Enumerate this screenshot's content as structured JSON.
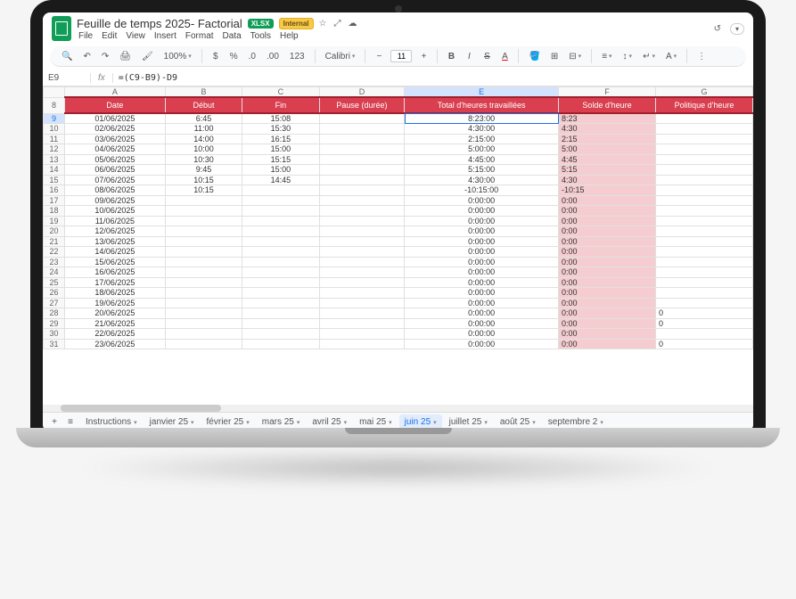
{
  "doc": {
    "name": "Feuille de temps 2025- Factorial",
    "badge_xlsx": "XLSX",
    "badge_internal": "Internal"
  },
  "menus": [
    "File",
    "Edit",
    "View",
    "Insert",
    "Format",
    "Data",
    "Tools",
    "Help"
  ],
  "toolbar": {
    "zoom": "100%",
    "font": "Calibri",
    "font_size": "11",
    "number_fmt": "123"
  },
  "formula": {
    "namebox": "E9",
    "fx": "fx",
    "value": "=(C9-B9)-D9"
  },
  "columns": [
    "A",
    "B",
    "C",
    "D",
    "E",
    "F",
    "G"
  ],
  "headers": {
    "A": "Date",
    "B": "Début",
    "C": "Fin",
    "D": "Pause (durée)",
    "E": "Total d'heures travaillées",
    "F": "Solde d'heure",
    "G": "Politique d'heure"
  },
  "chart_data": {
    "type": "table",
    "rows": [
      {
        "n": 9,
        "date": "01/06/2025",
        "debut": "6:45",
        "fin": "15:08",
        "pause": "",
        "total": "8:23:00",
        "solde": "8:23",
        "politique": ""
      },
      {
        "n": 10,
        "date": "02/06/2025",
        "debut": "11:00",
        "fin": "15:30",
        "pause": "",
        "total": "4:30:00",
        "solde": "4:30",
        "politique": ""
      },
      {
        "n": 11,
        "date": "03/06/2025",
        "debut": "14:00",
        "fin": "16:15",
        "pause": "",
        "total": "2:15:00",
        "solde": "2:15",
        "politique": ""
      },
      {
        "n": 12,
        "date": "04/06/2025",
        "debut": "10:00",
        "fin": "15:00",
        "pause": "",
        "total": "5:00:00",
        "solde": "5:00",
        "politique": ""
      },
      {
        "n": 13,
        "date": "05/06/2025",
        "debut": "10:30",
        "fin": "15:15",
        "pause": "",
        "total": "4:45:00",
        "solde": "4:45",
        "politique": ""
      },
      {
        "n": 14,
        "date": "06/06/2025",
        "debut": "9:45",
        "fin": "15:00",
        "pause": "",
        "total": "5:15:00",
        "solde": "5:15",
        "politique": ""
      },
      {
        "n": 15,
        "date": "07/06/2025",
        "debut": "10:15",
        "fin": "14:45",
        "pause": "",
        "total": "4:30:00",
        "solde": "4:30",
        "politique": ""
      },
      {
        "n": 16,
        "date": "08/06/2025",
        "debut": "10:15",
        "fin": "",
        "pause": "",
        "total": "-10:15:00",
        "solde": "-10:15",
        "politique": ""
      },
      {
        "n": 17,
        "date": "09/06/2025",
        "debut": "",
        "fin": "",
        "pause": "",
        "total": "0:00:00",
        "solde": "0:00",
        "politique": ""
      },
      {
        "n": 18,
        "date": "10/06/2025",
        "debut": "",
        "fin": "",
        "pause": "",
        "total": "0:00:00",
        "solde": "0:00",
        "politique": ""
      },
      {
        "n": 19,
        "date": "11/06/2025",
        "debut": "",
        "fin": "",
        "pause": "",
        "total": "0:00:00",
        "solde": "0:00",
        "politique": ""
      },
      {
        "n": 20,
        "date": "12/06/2025",
        "debut": "",
        "fin": "",
        "pause": "",
        "total": "0:00:00",
        "solde": "0:00",
        "politique": ""
      },
      {
        "n": 21,
        "date": "13/06/2025",
        "debut": "",
        "fin": "",
        "pause": "",
        "total": "0:00:00",
        "solde": "0:00",
        "politique": ""
      },
      {
        "n": 22,
        "date": "14/06/2025",
        "debut": "",
        "fin": "",
        "pause": "",
        "total": "0:00:00",
        "solde": "0:00",
        "politique": ""
      },
      {
        "n": 23,
        "date": "15/06/2025",
        "debut": "",
        "fin": "",
        "pause": "",
        "total": "0:00:00",
        "solde": "0:00",
        "politique": ""
      },
      {
        "n": 24,
        "date": "16/06/2025",
        "debut": "",
        "fin": "",
        "pause": "",
        "total": "0:00:00",
        "solde": "0:00",
        "politique": ""
      },
      {
        "n": 25,
        "date": "17/06/2025",
        "debut": "",
        "fin": "",
        "pause": "",
        "total": "0:00:00",
        "solde": "0:00",
        "politique": ""
      },
      {
        "n": 26,
        "date": "18/06/2025",
        "debut": "",
        "fin": "",
        "pause": "",
        "total": "0:00:00",
        "solde": "0:00",
        "politique": ""
      },
      {
        "n": 27,
        "date": "19/06/2025",
        "debut": "",
        "fin": "",
        "pause": "",
        "total": "0:00:00",
        "solde": "0:00",
        "politique": ""
      },
      {
        "n": 28,
        "date": "20/06/2025",
        "debut": "",
        "fin": "",
        "pause": "",
        "total": "0:00:00",
        "solde": "0:00",
        "politique": "0"
      },
      {
        "n": 29,
        "date": "21/06/2025",
        "debut": "",
        "fin": "",
        "pause": "",
        "total": "0:00:00",
        "solde": "0:00",
        "politique": "0"
      },
      {
        "n": 30,
        "date": "22/06/2025",
        "debut": "",
        "fin": "",
        "pause": "",
        "total": "0:00:00",
        "solde": "0:00",
        "politique": ""
      },
      {
        "n": 31,
        "date": "23/06/2025",
        "debut": "",
        "fin": "",
        "pause": "",
        "total": "0:00:00",
        "solde": "0:00",
        "politique": "0"
      }
    ]
  },
  "tabs": [
    "Instructions",
    "janvier 25",
    "février 25",
    "mars 25",
    "avril 25",
    "mai 25",
    "juin 25",
    "juillet 25",
    "août 25",
    "septembre 2"
  ],
  "active_tab": "juin 25",
  "header_row_num": "8"
}
